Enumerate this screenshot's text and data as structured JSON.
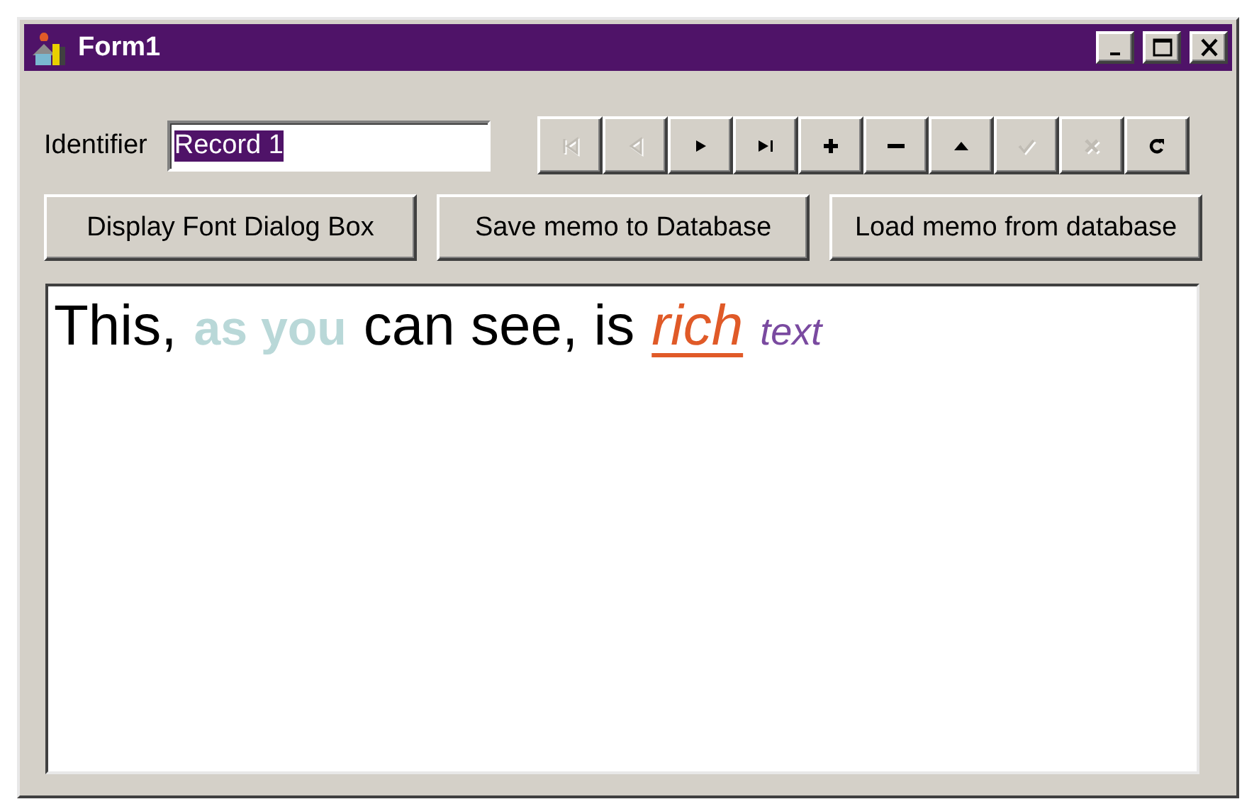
{
  "window": {
    "title": "Form1"
  },
  "identifier": {
    "label": "Identifier",
    "value": "Record 1",
    "selected": true
  },
  "navigator": [
    {
      "kind": "first",
      "disabled": true
    },
    {
      "kind": "prior",
      "disabled": true
    },
    {
      "kind": "next",
      "disabled": false
    },
    {
      "kind": "last",
      "disabled": false
    },
    {
      "kind": "insert",
      "disabled": false
    },
    {
      "kind": "delete",
      "disabled": false
    },
    {
      "kind": "edit",
      "disabled": false
    },
    {
      "kind": "post",
      "disabled": true
    },
    {
      "kind": "cancel",
      "disabled": true
    },
    {
      "kind": "refresh",
      "disabled": false
    }
  ],
  "buttons": [
    "Display Font Dialog Box",
    "Save memo to Database",
    "Load memo from database"
  ],
  "memo": [
    {
      "text": "This,",
      "kind": "plain",
      "color": "#000000"
    },
    {
      "text": "as you",
      "kind": "bold",
      "color": "#b9d8d8"
    },
    {
      "text": "can see, is",
      "kind": "plain",
      "color": "#000000"
    },
    {
      "text": "rich",
      "kind": "italic-underline",
      "color": "#e05a28"
    },
    {
      "text": "text",
      "kind": "italic-small",
      "color": "#7a4aa0"
    }
  ]
}
